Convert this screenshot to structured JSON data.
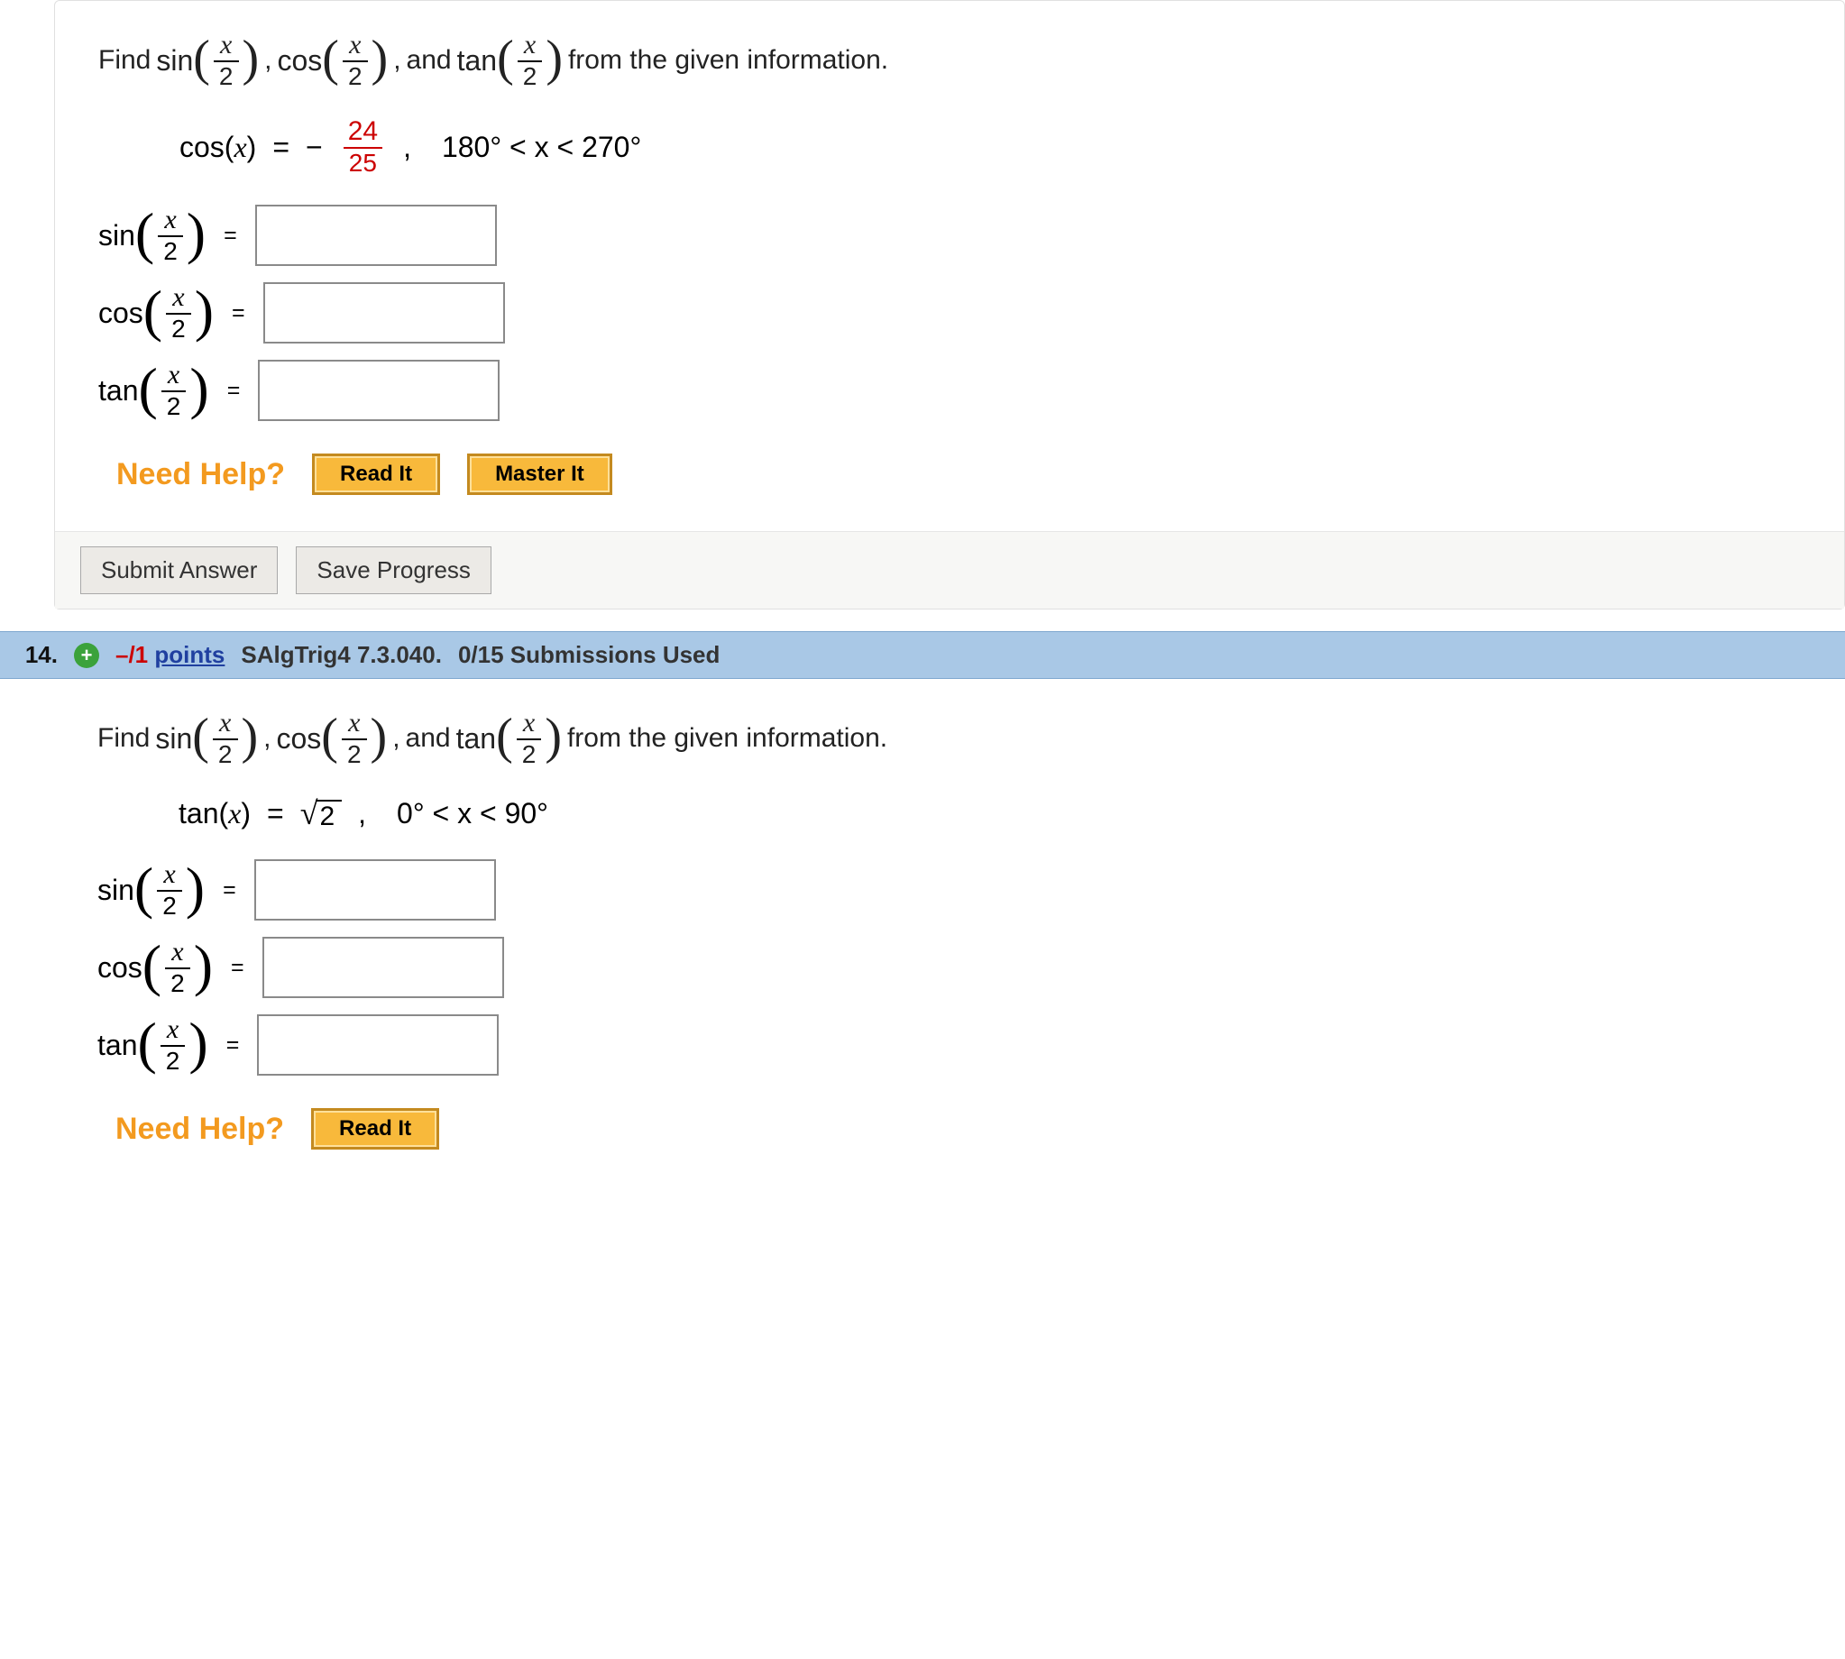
{
  "questions": {
    "q13": {
      "prompt_prefix": "Find",
      "prompt_middle": "and",
      "prompt_suffix": "from the given information.",
      "trig_fns": {
        "sin": "sin",
        "cos": "cos",
        "tan": "tan"
      },
      "half_arg_num": "x",
      "half_arg_den": "2",
      "given": {
        "lhs_fn": "cos",
        "lhs_arg": "x",
        "eq_sep": "=",
        "neg": "−",
        "frac_num": "24",
        "frac_den": "25",
        "range": "180° < x < 270°",
        "comma": ","
      },
      "answers": {
        "sin": "",
        "cos": "",
        "tan": ""
      },
      "help": {
        "label": "Need Help?",
        "read": "Read It",
        "master": "Master It"
      },
      "buttons": {
        "submit": "Submit Answer",
        "save": "Save Progress"
      }
    },
    "q14": {
      "header": {
        "num": "14.",
        "points_neg": "–/1",
        "points_word": "points",
        "ref": "SAlgTrig4 7.3.040.",
        "subs": "0/15 Submissions Used"
      },
      "prompt_prefix": "Find",
      "prompt_middle": "and",
      "prompt_suffix": "from the given information.",
      "trig_fns": {
        "sin": "sin",
        "cos": "cos",
        "tan": "tan"
      },
      "half_arg_num": "x",
      "half_arg_den": "2",
      "given": {
        "lhs_fn": "tan",
        "lhs_arg": "x",
        "eq_sep": "=",
        "sqrt_arg": "2",
        "range": "0° < x < 90°",
        "comma": ","
      },
      "answers": {
        "sin": "",
        "cos": "",
        "tan": ""
      },
      "help": {
        "label": "Need Help?",
        "read": "Read It"
      }
    }
  }
}
